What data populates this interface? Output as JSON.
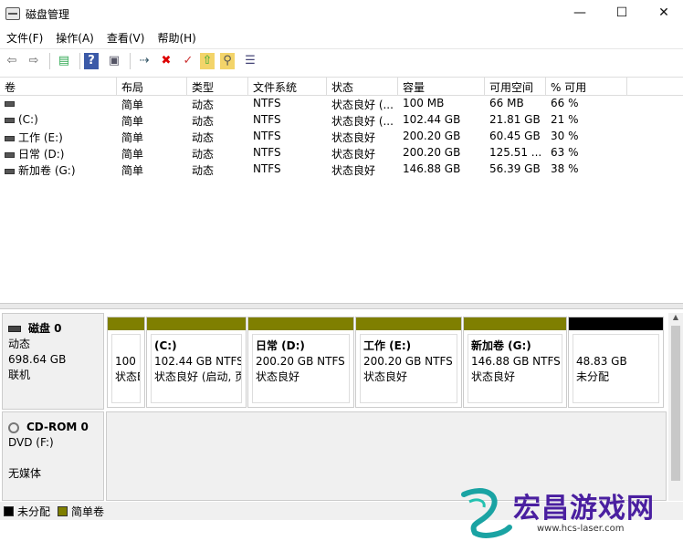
{
  "window": {
    "title": "磁盘管理",
    "minimize": "—",
    "maximize": "☐",
    "close": "✕"
  },
  "menu": [
    "文件(F)",
    "操作(A)",
    "查看(V)",
    "帮助(H)"
  ],
  "toolbar": {
    "back": "⇦",
    "forward": "⇨",
    "properties": "▤",
    "help": "?",
    "console": "▣",
    "connect": "⇢",
    "delete": "✖",
    "check": "✓",
    "export": "⇧",
    "search": "⚲",
    "settings": "☰"
  },
  "volume_table": {
    "headers": [
      "卷",
      "布局",
      "类型",
      "文件系统",
      "状态",
      "容量",
      "可用空间",
      "% 可用"
    ],
    "rows": [
      [
        "",
        "简单",
        "动态",
        "NTFS",
        "状态良好 (...",
        "100 MB",
        "66 MB",
        "66 %"
      ],
      [
        "(C:)",
        "简单",
        "动态",
        "NTFS",
        "状态良好 (...",
        "102.44 GB",
        "21.81 GB",
        "21 %"
      ],
      [
        "工作 (E:)",
        "简单",
        "动态",
        "NTFS",
        "状态良好",
        "200.20 GB",
        "60.45 GB",
        "30 %"
      ],
      [
        "日常 (D:)",
        "简单",
        "动态",
        "NTFS",
        "状态良好",
        "200.20 GB",
        "125.51 ...",
        "63 %"
      ],
      [
        "新加卷 (G:)",
        "简单",
        "动态",
        "NTFS",
        "状态良好",
        "146.88 GB",
        "56.39 GB",
        "38 %"
      ]
    ]
  },
  "disk0": {
    "name": "磁盘 0",
    "type": "动态",
    "size": "698.64 GB",
    "status": "联机",
    "partitions": [
      {
        "name": "",
        "size": "100 I",
        "status": "状态E"
      },
      {
        "name": "(C:)",
        "size": "102.44 GB NTFS",
        "status": "状态良好 (启动, 页"
      },
      {
        "name": "日常  (D:)",
        "size": "200.20 GB NTFS",
        "status": "状态良好"
      },
      {
        "name": "工作  (E:)",
        "size": "200.20 GB NTFS",
        "status": "状态良好"
      },
      {
        "name": "新加卷  (G:)",
        "size": "146.88 GB NTFS",
        "status": "状态良好"
      },
      {
        "name": "",
        "size": "48.83 GB",
        "status": "未分配"
      }
    ]
  },
  "cdrom": {
    "name": "CD-ROM 0",
    "drive": "DVD (F:)",
    "media": "无媒体"
  },
  "legend": {
    "unallocated": "未分配",
    "simple": "简单卷",
    "unallocated_color": "#000000",
    "simple_color": "#7f7f00"
  },
  "watermark": {
    "title": "宏昌游戏网",
    "url": "www.hcs-laser.com"
  }
}
